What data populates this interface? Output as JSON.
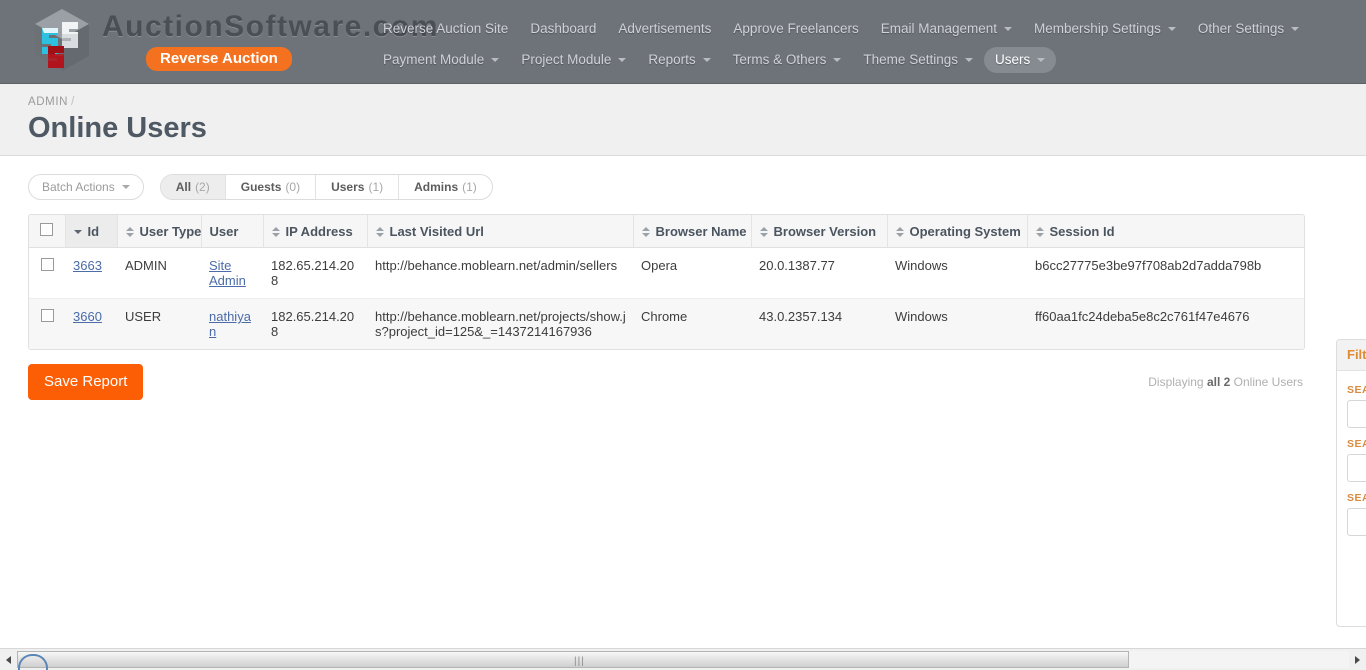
{
  "brand": {
    "name": "AuctionSoftware.com",
    "badge": "Reverse Auction",
    "logo_icon": "auction-software-cube-logo"
  },
  "nav": {
    "row1": [
      {
        "label": "Reverse Auction Site",
        "dropdown": false,
        "active": false
      },
      {
        "label": "Dashboard",
        "dropdown": false,
        "active": false
      },
      {
        "label": "Advertisements",
        "dropdown": false,
        "active": false
      },
      {
        "label": "Approve Freelancers",
        "dropdown": false,
        "active": false
      },
      {
        "label": "Email Management",
        "dropdown": true,
        "active": false
      },
      {
        "label": "Membership Settings",
        "dropdown": true,
        "active": false
      },
      {
        "label": "Other Settings",
        "dropdown": true,
        "active": false
      }
    ],
    "row2": [
      {
        "label": "Payment Module",
        "dropdown": true,
        "active": false
      },
      {
        "label": "Project Module",
        "dropdown": true,
        "active": false
      },
      {
        "label": "Reports",
        "dropdown": true,
        "active": false
      },
      {
        "label": "Terms & Others",
        "dropdown": true,
        "active": false
      },
      {
        "label": "Theme Settings",
        "dropdown": true,
        "active": false
      },
      {
        "label": "Users",
        "dropdown": true,
        "active": true
      }
    ]
  },
  "page": {
    "breadcrumb": "ADMIN",
    "breadcrumb_separator": "/",
    "title": "Online Users"
  },
  "toolbar": {
    "batch_actions_label": "Batch Actions",
    "scopes": [
      {
        "label": "All",
        "count": "(2)",
        "active": true
      },
      {
        "label": "Guests",
        "count": "(0)",
        "active": false
      },
      {
        "label": "Users",
        "count": "(1)",
        "active": false
      },
      {
        "label": "Admins",
        "count": "(1)",
        "active": false
      }
    ]
  },
  "table": {
    "columns": [
      {
        "label": "Id",
        "sortable": true,
        "sorted": "desc"
      },
      {
        "label": "User Type",
        "sortable": true,
        "sorted": "none"
      },
      {
        "label": "User",
        "sortable": false,
        "sorted": "none"
      },
      {
        "label": "IP Address",
        "sortable": true,
        "sorted": "none"
      },
      {
        "label": "Last Visited Url",
        "sortable": true,
        "sorted": "none"
      },
      {
        "label": "Browser Name",
        "sortable": true,
        "sorted": "none"
      },
      {
        "label": "Browser Version",
        "sortable": true,
        "sorted": "none"
      },
      {
        "label": "Operating System",
        "sortable": true,
        "sorted": "none"
      },
      {
        "label": "Session Id",
        "sortable": true,
        "sorted": "none"
      }
    ],
    "rows": [
      {
        "id": "3663",
        "user_type": "ADMIN",
        "user": "Site Admin",
        "ip_address": "182.65.214.208",
        "last_visited_url": "http://behance.moblearn.net/admin/sellers",
        "browser_name": "Opera",
        "browser_version": "20.0.1387.77",
        "operating_system": "Windows",
        "session_id": "b6cc27775e3be97f708ab2d7adda798b"
      },
      {
        "id": "3660",
        "user_type": "USER",
        "user": "nathiyan",
        "ip_address": "182.65.214.208",
        "last_visited_url": "http://behance.moblearn.net/projects/show.js?project_id=125&_=1437214167936",
        "browser_name": "Chrome",
        "browser_version": "43.0.2357.134",
        "operating_system": "Windows",
        "session_id": "ff60aa1fc24deba5e8c2c761f47e4676"
      }
    ]
  },
  "footer": {
    "save_report_label": "Save Report",
    "displaying_prefix": "Displaying",
    "displaying_emphasis": "all 2",
    "displaying_suffix": "Online Users"
  },
  "filters": {
    "tab_label": "Filters",
    "fields": [
      {
        "label": "SEARCH",
        "value": ""
      },
      {
        "label": "SEARCH",
        "value": ""
      },
      {
        "label": "SEARCH",
        "value": ""
      }
    ]
  },
  "scrollbar": {
    "left_arrow_icon": "chevron-left-icon",
    "right_arrow_icon": "chevron-right-icon",
    "grip_icon": "scrollbar-grip"
  },
  "colors": {
    "header_bg": "#6e737a",
    "accent_orange": "#f4711f",
    "save_button": "#fb5e05",
    "link_blue": "#4b6ca8",
    "title_slate": "#4e5964"
  }
}
